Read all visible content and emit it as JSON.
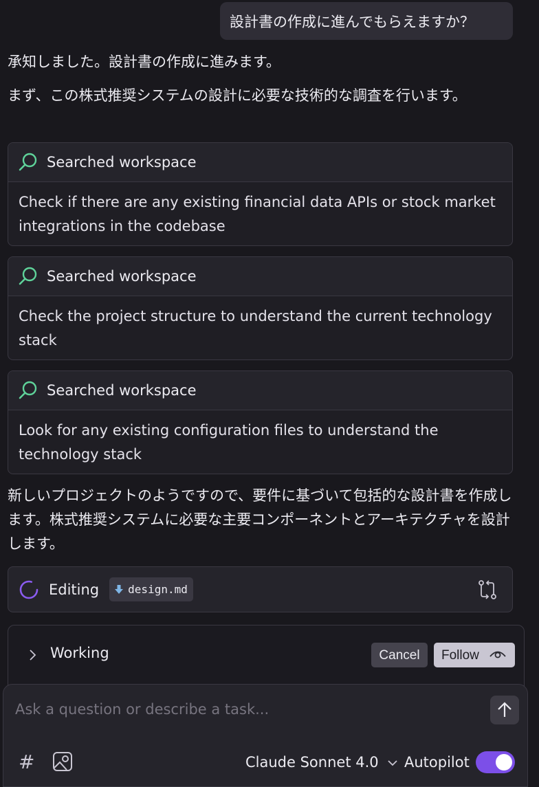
{
  "user_message": "設計書の作成に進んでもらえますか？",
  "assistant": {
    "p1": "承知しました。設計書の作成に進みます。",
    "p2": "まず、この株式推奨システムの設計に必要な技術的な調査を行います。",
    "p3": "新しいプロジェクトのようですので、要件に基づいて包括的な設計書を作成します。株式推奨システムに必要な主要コンポーネントとアーキテクチャを設計します。"
  },
  "search_cards": [
    {
      "title": "Searched workspace",
      "description": "Check if there are any existing financial data APIs or stock market integrations in the codebase"
    },
    {
      "title": "Searched workspace",
      "description": "Check the project structure to understand the current technology stack"
    },
    {
      "title": "Searched workspace",
      "description": "Look for any existing configuration files to understand the technology stack"
    }
  ],
  "editing": {
    "label": "Editing",
    "file": "design.md"
  },
  "working": {
    "label": "Working",
    "cancel_label": "Cancel",
    "follow_label": "Follow"
  },
  "composer": {
    "placeholder": "Ask a question or describe a task...",
    "hash_label": "#",
    "model": "Claude Sonnet 4.0",
    "autopilot_label": "Autopilot",
    "autopilot_on": true
  },
  "colors": {
    "accent": "#7c4fe8",
    "search_icon": "#5fd39a",
    "spinner": "#8a5cf0",
    "background": "#19181d"
  }
}
